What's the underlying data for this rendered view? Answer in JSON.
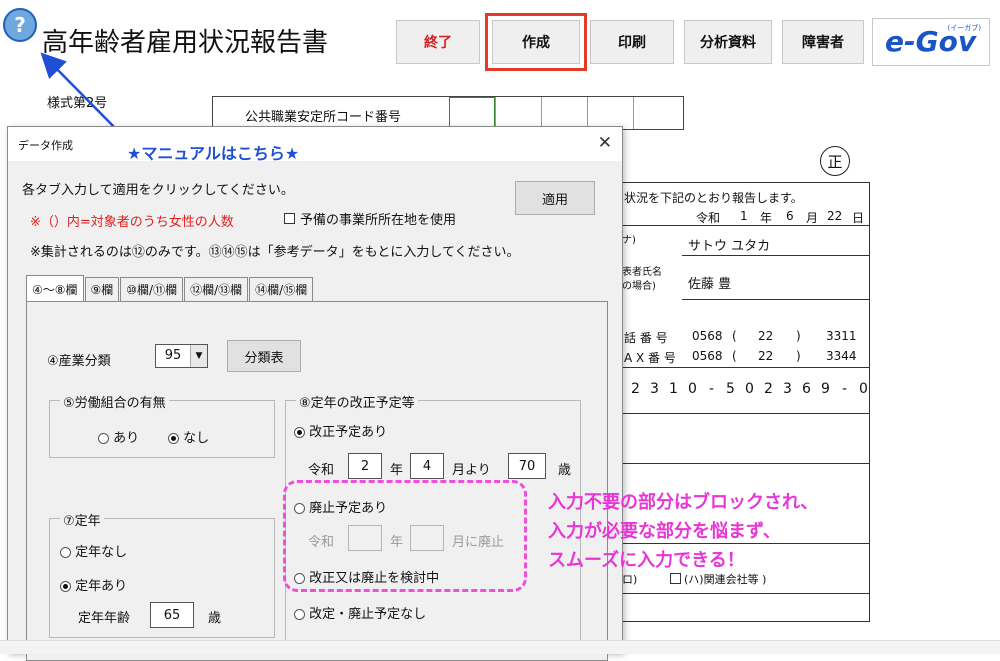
{
  "app": {
    "title": "高年齢者雇用状況報告書",
    "help_glyph": "?"
  },
  "toolbar": {
    "exit": "終了",
    "create": "作成",
    "print": "印刷",
    "analysis": "分析資料",
    "disabled": "障害者",
    "egov_logo": "e-Gov",
    "egov_kana": "(イーガブ)"
  },
  "form": {
    "form_no": "様式第2号",
    "office_code_label": "公共職業安定所コード番号",
    "sei": "正",
    "report_line": "状況を下記のとおり報告します。",
    "date": {
      "era": "令和",
      "year": "1",
      "year_unit": "年",
      "month": "6",
      "month_unit": "月",
      "day": "22",
      "day_unit": "日"
    },
    "furigana_mark": "ナ)",
    "name_kana": "サトウ ユタカ",
    "rep_label_1": "表者氏名",
    "rep_label_2": "の場合)",
    "rep_name": "佐藤 豊",
    "tel_label": "話 番 号",
    "tel": [
      "0568",
      "(",
      "22",
      ")",
      "3311"
    ],
    "fax_label": "A X 番 号",
    "fax": [
      "0568",
      "(",
      "22",
      ")",
      "3344"
    ],
    "number_cells": [
      "2",
      "3",
      "1",
      "0",
      "-",
      "5",
      "0",
      "2",
      "3",
      "6",
      "9",
      "-",
      "0"
    ],
    "affiliate_label": "(ハ)関連会社等 )",
    "affiliate_prefix": "ロ)"
  },
  "annotation": {
    "manual": "★マニュアルはこちら★",
    "note_lines": [
      "入力不要の部分はブロックされ、",
      "入力が必要な部分を悩まず、",
      "スムーズに入力できる！"
    ]
  },
  "dialog": {
    "title": "データ作成",
    "close": "✕",
    "instruction": "各タブ入力して適用をクリックしてください。",
    "apply": "適用",
    "female_note": "※（）内=対象者のうち女性の人数",
    "reserve_office": "予備の事業所所在地を使用",
    "aggregate_note": "※集計されるのは⑫のみです。⑬⑭⑮は「参考データ」をもとに入力してください。",
    "tabs": [
      "④～⑧欄",
      "⑨欄",
      "⑩欄/⑪欄",
      "⑫欄/⑬欄",
      "⑭欄/⑮欄"
    ],
    "industry": {
      "label": "④産業分類",
      "value": "95",
      "table_button": "分類表"
    },
    "union": {
      "legend": "⑤労働組合の有無",
      "yes": "あり",
      "no": "なし",
      "selected": "なし"
    },
    "retirement": {
      "legend": "⑦定年",
      "none": "定年なし",
      "exists": "定年あり",
      "age_label": "定年年齢",
      "age": "65",
      "age_unit": "歳",
      "selected": "定年あり"
    },
    "revision": {
      "legend": "⑧定年の改正予定等",
      "planned": "改正予定あり",
      "era": "令和",
      "year": "2",
      "year_unit": "年",
      "month": "4",
      "from": "月より",
      "age": "70",
      "age_unit": "歳",
      "abolish": "廃止予定あり",
      "abolish_era": "令和",
      "abolish_year_unit": "年",
      "abolish_suffix": "月に廃止",
      "considering": "改正又は廃止を検討中",
      "none": "改定・廃止予定なし",
      "selected": "改正予定あり"
    }
  },
  "colors": {
    "exit_text": "#d62020",
    "highlight": "#e53a2a",
    "annotation_blue": "#1e4fd6",
    "annotation_pink": "#e836d6",
    "red_note": "#e0201f"
  }
}
